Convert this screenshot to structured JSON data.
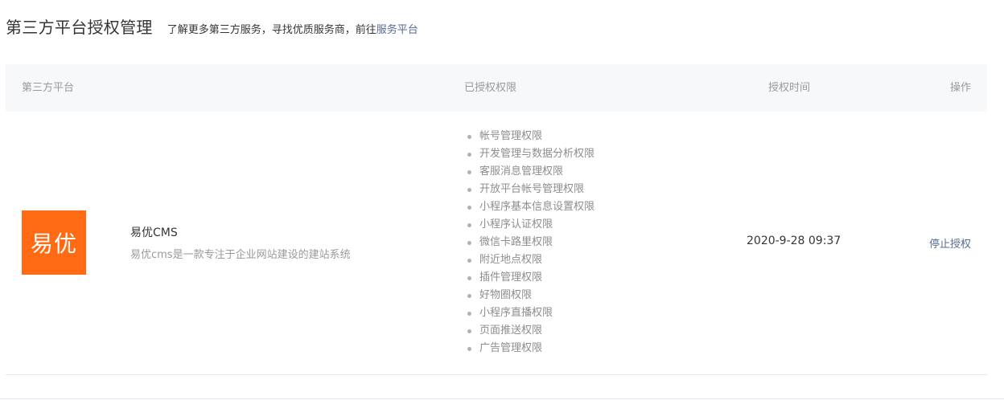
{
  "header": {
    "title": "第三方平台授权管理",
    "description_prefix": "了解更多第三方服务，寻找优质服务商，前往",
    "service_link": "服务平台"
  },
  "table": {
    "columns": {
      "platform": "第三方平台",
      "permissions": "已授权权限",
      "time": "授权时间",
      "action": "操作"
    },
    "rows": [
      {
        "logo_text": "易优",
        "logo_color": "#ff6a13",
        "name": "易优CMS",
        "description": "易优cms是一款专注于企业网站建设的建站系统",
        "permissions": [
          "帐号管理权限",
          "开发管理与数据分析权限",
          "客服消息管理权限",
          "开放平台帐号管理权限",
          "小程序基本信息设置权限",
          "小程序认证权限",
          "微信卡路里权限",
          "附近地点权限",
          "插件管理权限",
          "好物圈权限",
          "小程序直播权限",
          "页面推送权限",
          "广告管理权限"
        ],
        "auth_time": "2020-9-28 09:37",
        "action_label": "停止授权"
      }
    ]
  },
  "colors": {
    "link": "#576b95",
    "header_bg": "#f6f8f9",
    "brand_orange": "#ff6a13"
  }
}
